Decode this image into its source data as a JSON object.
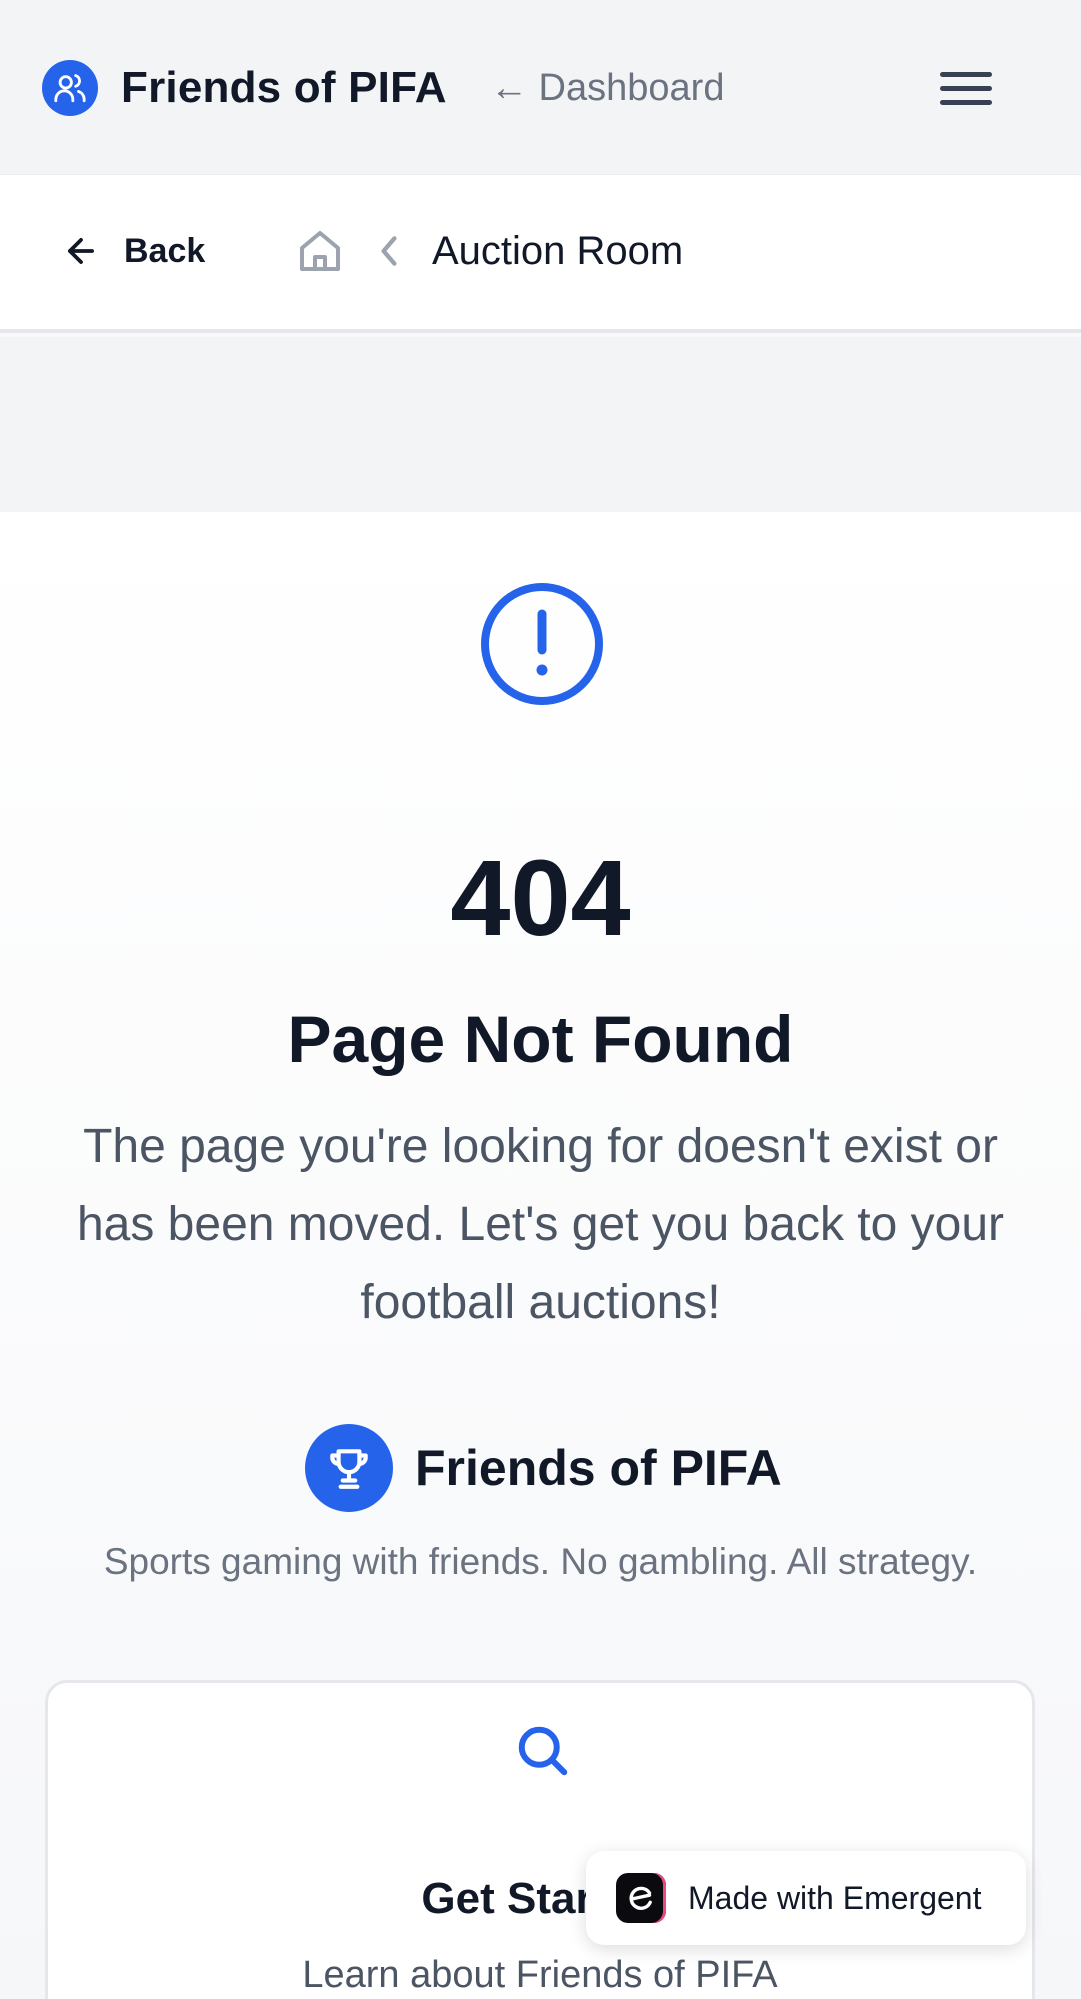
{
  "header": {
    "brand_title": "Friends of PIFA",
    "dashboard_link": "← Dashboard",
    "brand_icon": "users-icon",
    "menu_icon": "hamburger-menu-icon"
  },
  "breadcrumb": {
    "back_label": "Back",
    "home_icon": "home-icon",
    "separator_icon": "chevron-left-icon",
    "current": "Auction Room"
  },
  "error": {
    "icon": "alert-circle-icon",
    "code": "404",
    "title": "Page Not Found",
    "message": "The page you're looking for doesn't exist or has been moved. Let's get you back to your football auctions!"
  },
  "brand_block": {
    "icon": "trophy-icon",
    "name": "Friends of PIFA",
    "tagline": "Sports gaming with friends. No gambling. All strategy."
  },
  "card": {
    "icon": "search-icon",
    "title": "Get Started",
    "description": "Learn about Friends of PIFA"
  },
  "badge": {
    "text": "Made with Emergent",
    "icon": "emergent-logo-icon"
  },
  "colors": {
    "accent": "#2563eb",
    "text_dark": "#111827",
    "text_muted": "#6b7280"
  }
}
